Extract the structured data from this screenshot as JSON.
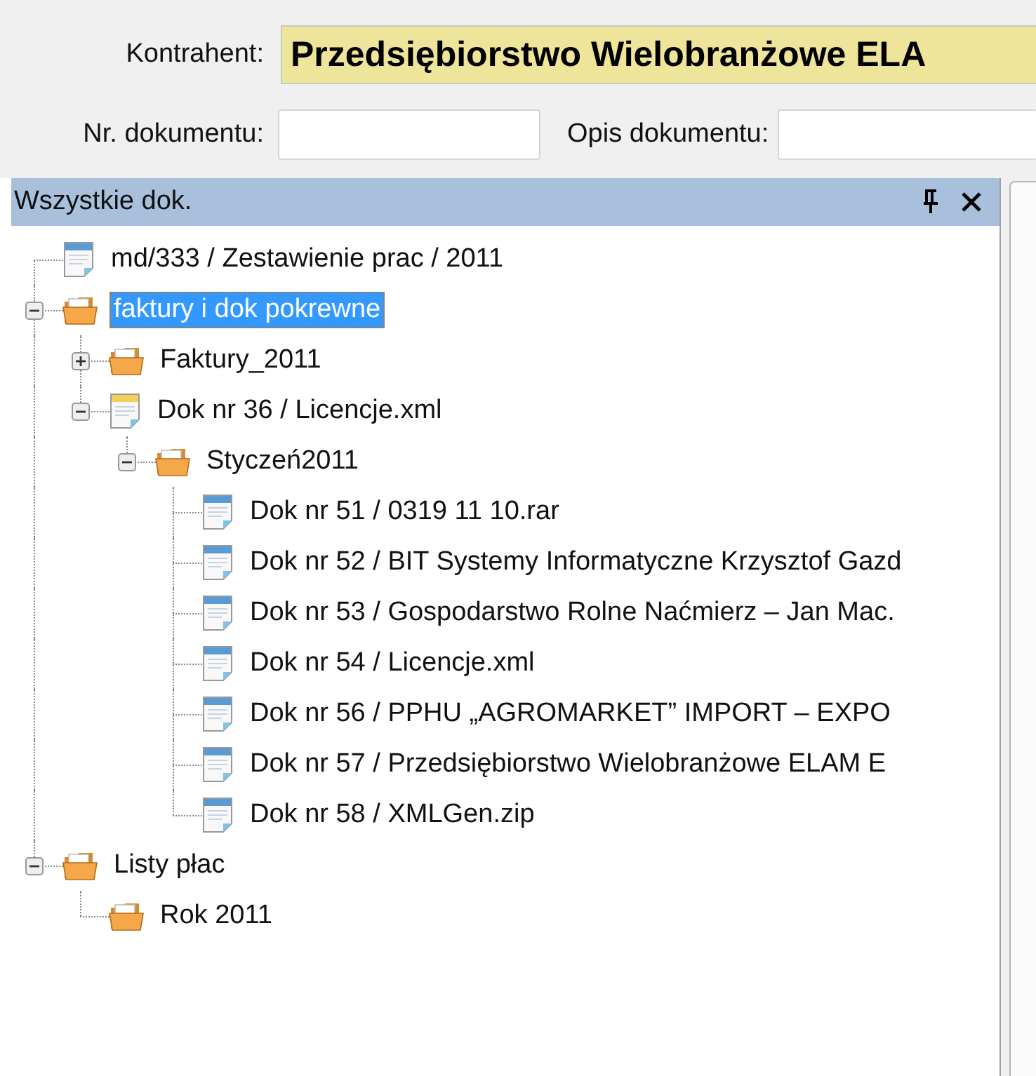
{
  "form": {
    "contractor": {
      "label": "Kontrahent:",
      "value": "Przedsiębiorstwo Wielobranżowe ELA"
    },
    "document_number": {
      "label": "Nr. dokumentu:"
    },
    "document_description": {
      "label": "Opis dokumentu:"
    }
  },
  "panel": {
    "title": "Wszystkie dok.",
    "tree": [
      {
        "label": "md/333 / Zestawienie prac / 2011",
        "kind": "document",
        "selected": false
      },
      {
        "label": "faktury i dok pokrewne",
        "kind": "folder",
        "selected": true,
        "expanded": true,
        "children": [
          {
            "label": "Faktury_2011",
            "kind": "folder",
            "selected": false,
            "expanded": false
          },
          {
            "label": "Dok nr 36 / Licencje.xml",
            "kind": "draft",
            "selected": false,
            "expanded": true,
            "children": [
              {
                "label": "Styczeń2011",
                "kind": "folder",
                "selected": false,
                "expanded": true,
                "children": [
                  {
                    "label": "Dok nr 51 / 0319 11 10.rar",
                    "kind": "document",
                    "selected": false
                  },
                  {
                    "label": "Dok nr 52 / BIT Systemy Informatyczne Krzysztof Gazd",
                    "kind": "document",
                    "selected": false
                  },
                  {
                    "label": "Dok nr 53 / Gospodarstwo Rolne Naćmierz – Jan Mac.",
                    "kind": "document",
                    "selected": false
                  },
                  {
                    "label": "Dok nr 54 / Licencje.xml",
                    "kind": "document",
                    "selected": false
                  },
                  {
                    "label": "Dok nr 56 / PPHU „AGROMARKET” IMPORT – EXPO",
                    "kind": "document",
                    "selected": false
                  },
                  {
                    "label": "Dok nr 57 / Przedsiębiorstwo Wielobranżowe ELAM  E",
                    "kind": "document",
                    "selected": false
                  },
                  {
                    "label": "Dok nr 58 / XMLGen.zip",
                    "kind": "document",
                    "selected": false
                  }
                ]
              }
            ]
          }
        ]
      },
      {
        "label": "Listy płac",
        "kind": "folder",
        "selected": false,
        "expanded": true,
        "children": [
          {
            "label": "Rok 2011",
            "kind": "folder",
            "selected": false
          }
        ]
      }
    ]
  }
}
